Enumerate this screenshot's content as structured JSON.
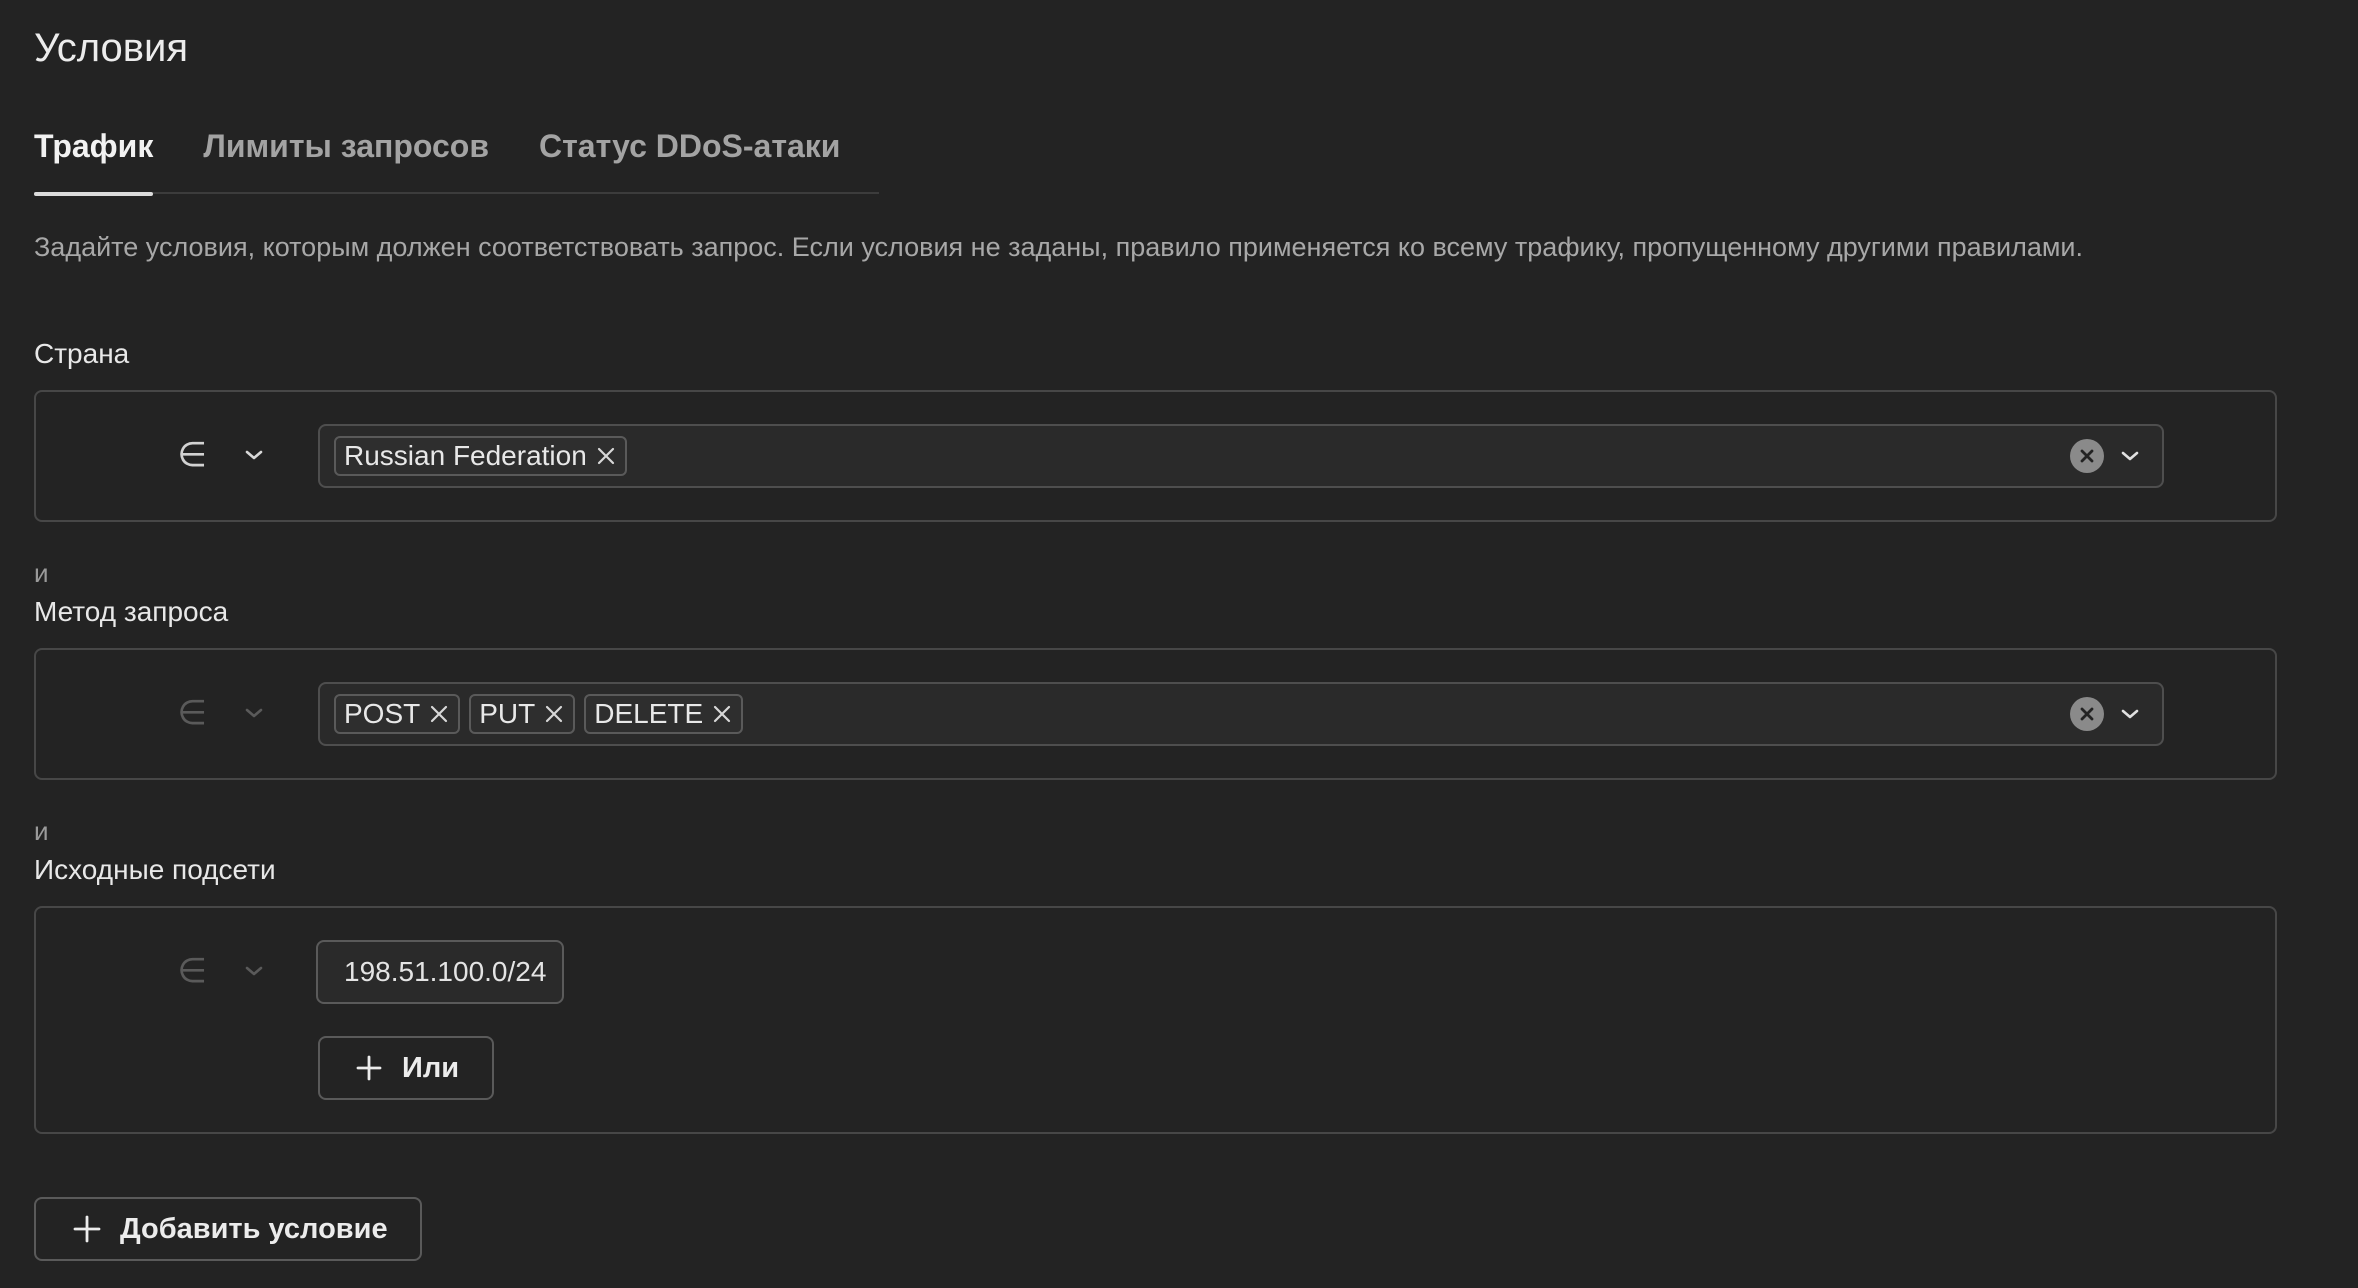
{
  "page": {
    "title": "Условия"
  },
  "tabs": [
    {
      "label": "Трафик",
      "active": true
    },
    {
      "label": "Лимиты запросов",
      "active": false
    },
    {
      "label": "Статус DDoS-атаки",
      "active": false
    }
  ],
  "description": "Задайте условия, которым должен соответствовать запрос. Если условия не заданы, правило применяется ко всему трафику, пропущенному другими правилами.",
  "conditions": {
    "country": {
      "label": "Страна",
      "operator": "∈",
      "chips": [
        "Russian Federation"
      ]
    },
    "joiner_1": "и",
    "method": {
      "label": "Метод запроса",
      "operator": "∈",
      "chips": [
        "POST",
        "PUT",
        "DELETE"
      ]
    },
    "joiner_2": "и",
    "subnets": {
      "label": "Исходные подсети",
      "operator": "∈",
      "value": "198.51.100.0/24",
      "or_button": "Или"
    }
  },
  "add_condition_button": "Добавить условие",
  "colors": {
    "background": "#232323",
    "border": "#474747",
    "text": "#e6e6e6",
    "muted": "#a8a8a8"
  },
  "icons": [
    "element-of-icon",
    "chevron-down-icon",
    "close-icon",
    "clear-icon",
    "plus-icon"
  ]
}
